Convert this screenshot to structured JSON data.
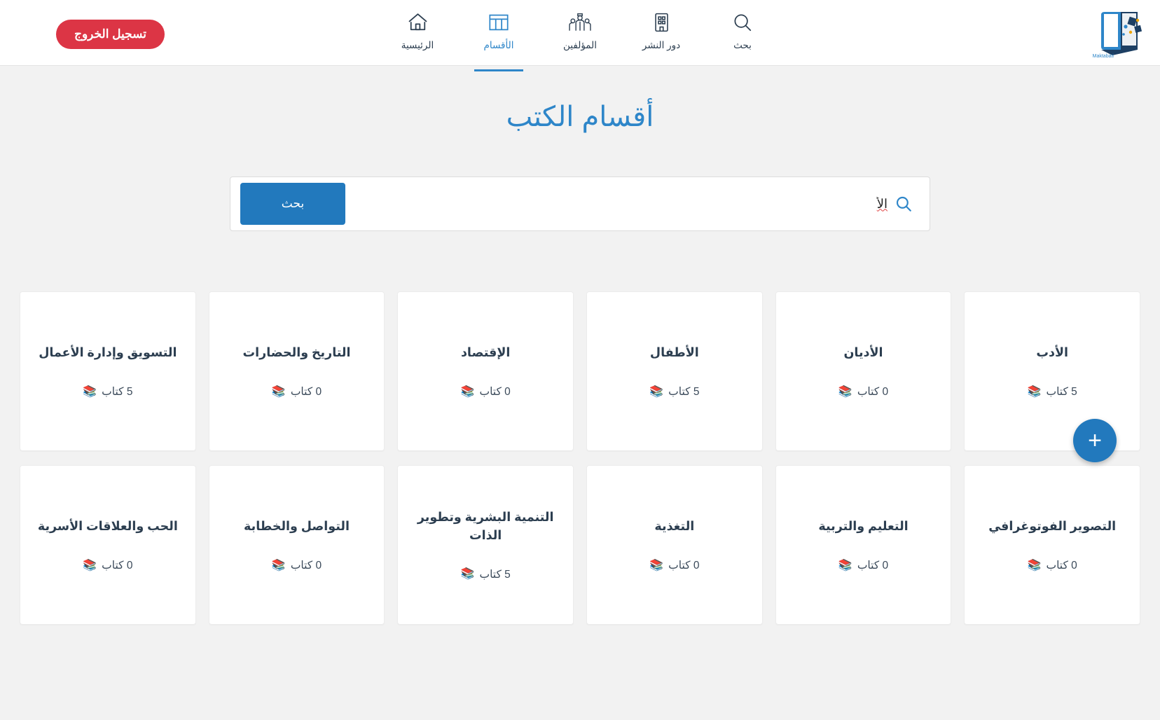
{
  "topbar": {
    "logout_label": "تسجيل الخروج",
    "nav": [
      {
        "label": "بحث",
        "icon": "search-icon",
        "active": false
      },
      {
        "label": "دور النشر",
        "icon": "building-icon",
        "active": false
      },
      {
        "label": "المؤلفين",
        "icon": "authors-icon",
        "active": false
      },
      {
        "label": "الأقسام",
        "icon": "sections-grid-icon",
        "active": true
      },
      {
        "label": "الرئيسية",
        "icon": "home-icon",
        "active": false
      }
    ],
    "logo_alt": "book-logo"
  },
  "page": {
    "title": "أقسام الكتب"
  },
  "search": {
    "button_label": "بحث",
    "value": "الأ",
    "placeholder": "",
    "icon": "magnifier-icon"
  },
  "sections": [
    {
      "title": "الأدب",
      "count_text": "5 كتاب",
      "icon": "books-icon"
    },
    {
      "title": "الأديان",
      "count_text": "0 كتاب",
      "icon": "books-icon"
    },
    {
      "title": "الأطفال",
      "count_text": "5 كتاب",
      "icon": "books-icon"
    },
    {
      "title": "الإقتصاد",
      "count_text": "0 كتاب",
      "icon": "books-icon"
    },
    {
      "title": "التاريخ والحضارات",
      "count_text": "0 كتاب",
      "icon": "books-icon"
    },
    {
      "title": "التسويق وإدارة الأعمال",
      "count_text": "5 كتاب",
      "icon": "books-icon"
    },
    {
      "title": "التصوير الفوتوغرافي",
      "count_text": "0 كتاب",
      "icon": "books-icon"
    },
    {
      "title": "التعليم والتربية",
      "count_text": "0 كتاب",
      "icon": "books-icon"
    },
    {
      "title": "التغذية",
      "count_text": "0 كتاب",
      "icon": "books-icon"
    },
    {
      "title": "التنمية البشرية وتطوير الذات",
      "count_text": "5 كتاب",
      "icon": "books-icon"
    },
    {
      "title": "التواصل والخطابة",
      "count_text": "0 كتاب",
      "icon": "books-icon"
    },
    {
      "title": "الحب والعلاقات الأسرية",
      "count_text": "0 كتاب",
      "icon": "books-icon"
    }
  ],
  "fab": {
    "label": "+"
  },
  "colors": {
    "accent_blue": "#2e86c9",
    "button_blue": "#2279bd",
    "danger_red": "#dc3545",
    "page_bg": "#f2f2f2",
    "text_dark": "#2c3e50"
  }
}
